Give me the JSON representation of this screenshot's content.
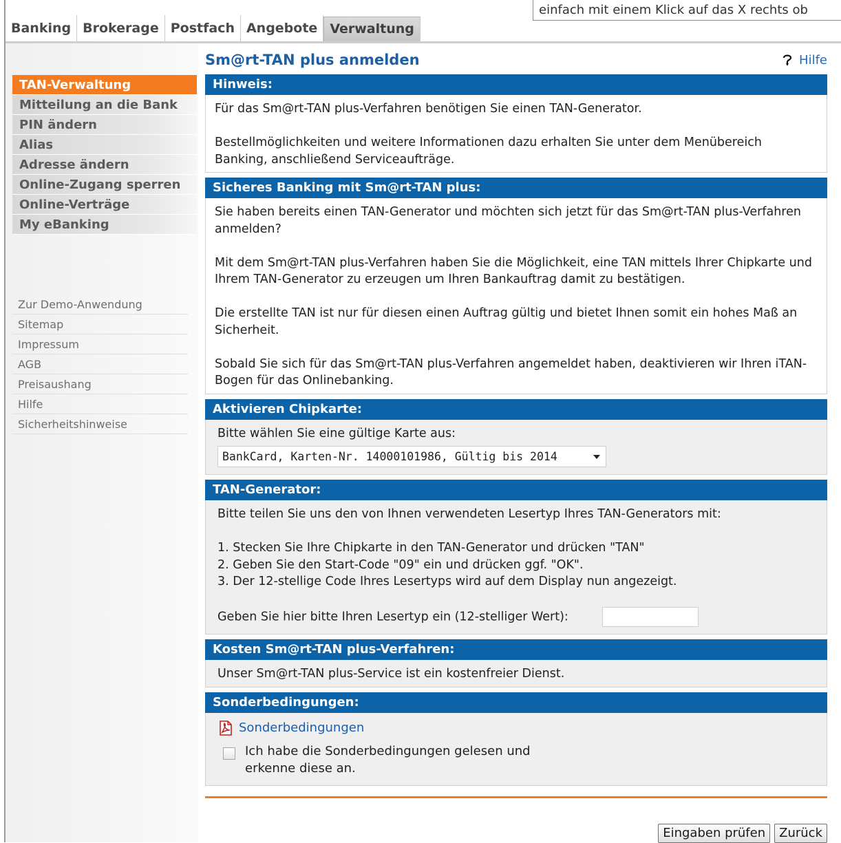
{
  "top_nav": {
    "tabs": [
      {
        "label": "Banking"
      },
      {
        "label": "Brokerage"
      },
      {
        "label": "Postfach"
      },
      {
        "label": "Angebote"
      },
      {
        "label": "Verwaltung"
      }
    ],
    "marquee_text": "einfach mit einem Klick auf das X rechts ob"
  },
  "sidebar": {
    "nav": [
      {
        "label": "TAN-Verwaltung"
      },
      {
        "label": "Mitteilung an die Bank"
      },
      {
        "label": "PIN ändern"
      },
      {
        "label": "Alias"
      },
      {
        "label": "Adresse ändern"
      },
      {
        "label": "Online-Zugang sperren"
      },
      {
        "label": "Online-Verträge"
      },
      {
        "label": "My eBanking"
      }
    ],
    "links": [
      {
        "label": "Zur Demo-Anwendung"
      },
      {
        "label": "Sitemap"
      },
      {
        "label": "Impressum"
      },
      {
        "label": "AGB"
      },
      {
        "label": "Preisaushang"
      },
      {
        "label": "Hilfe"
      },
      {
        "label": "Sicherheitshinweise"
      }
    ]
  },
  "main": {
    "title": "Sm@rt-TAN plus anmelden",
    "help_label": "Hilfe",
    "hinweis": {
      "header": "Hinweis:",
      "paragraphs": [
        "Für das Sm@rt-TAN plus-Verfahren benötigen Sie einen TAN-Generator.",
        "Bestellmöglichkeiten und weitere Informationen dazu erhalten Sie unter dem Menübereich Banking, anschließend Serviceaufträge."
      ]
    },
    "sicheres": {
      "header": "Sicheres Banking mit Sm@rt-TAN plus:",
      "paragraphs": [
        "Sie haben bereits einen TAN-Generator und möchten sich jetzt für das Sm@rt-TAN plus-Verfahren anmelden?",
        "Mit dem Sm@rt-TAN plus-Verfahren haben Sie die Möglichkeit, eine TAN mittels Ihrer Chipkarte und Ihrem TAN-Generator zu erzeugen um Ihren Bankauftrag damit zu bestätigen.",
        "Die erstellte TAN ist nur für diesen einen Auftrag gültig und bietet Ihnen somit ein hohes Maß an Sicherheit.",
        "Sobald Sie sich für das Sm@rt-TAN plus-Verfahren angemeldet haben, deaktivieren wir Ihren iTAN-Bogen für das Onlinebanking."
      ]
    },
    "chipkarte": {
      "header": "Aktivieren Chipkarte:",
      "prompt": "Bitte wählen Sie eine gültige Karte aus:",
      "selected_card": "BankCard, Karten-Nr. 14000101986, Gültig bis 2014"
    },
    "generator": {
      "header": "TAN-Generator:",
      "intro": "Bitte teilen Sie uns den von Ihnen verwendeten Lesertyp Ihres TAN-Generators mit:",
      "steps": [
        "1. Stecken Sie Ihre Chipkarte in den TAN-Generator und drücken \"TAN\"",
        "2. Geben Sie den Start-Code \"09\" ein und drücken ggf. \"OK\".",
        "3. Der 12-stellige Code Ihres Lesertyps wird auf dem Display nun angezeigt."
      ],
      "input_label": "Geben Sie hier bitte Ihren Lesertyp ein (12-stelliger Wert):",
      "input_value": ""
    },
    "kosten": {
      "header": "Kosten Sm@rt-TAN plus-Verfahren:",
      "text": "Unser Sm@rt-TAN plus-Service ist ein kostenfreier Dienst."
    },
    "sonder": {
      "header": "Sonderbedingungen:",
      "link_label": "Sonderbedingungen",
      "checkbox_label": "Ich habe die Sonderbedingungen gelesen und erkenne diese an."
    }
  },
  "buttons": {
    "check_label": "Eingaben prüfen",
    "back_label": "Zurück"
  },
  "colors": {
    "header_blue": "#0d63a8",
    "active_orange": "#f47b20",
    "title_blue": "#1c5fa5"
  },
  "icons": [
    "help-question-icon",
    "pdf-icon",
    "dropdown-arrow-icon"
  ]
}
